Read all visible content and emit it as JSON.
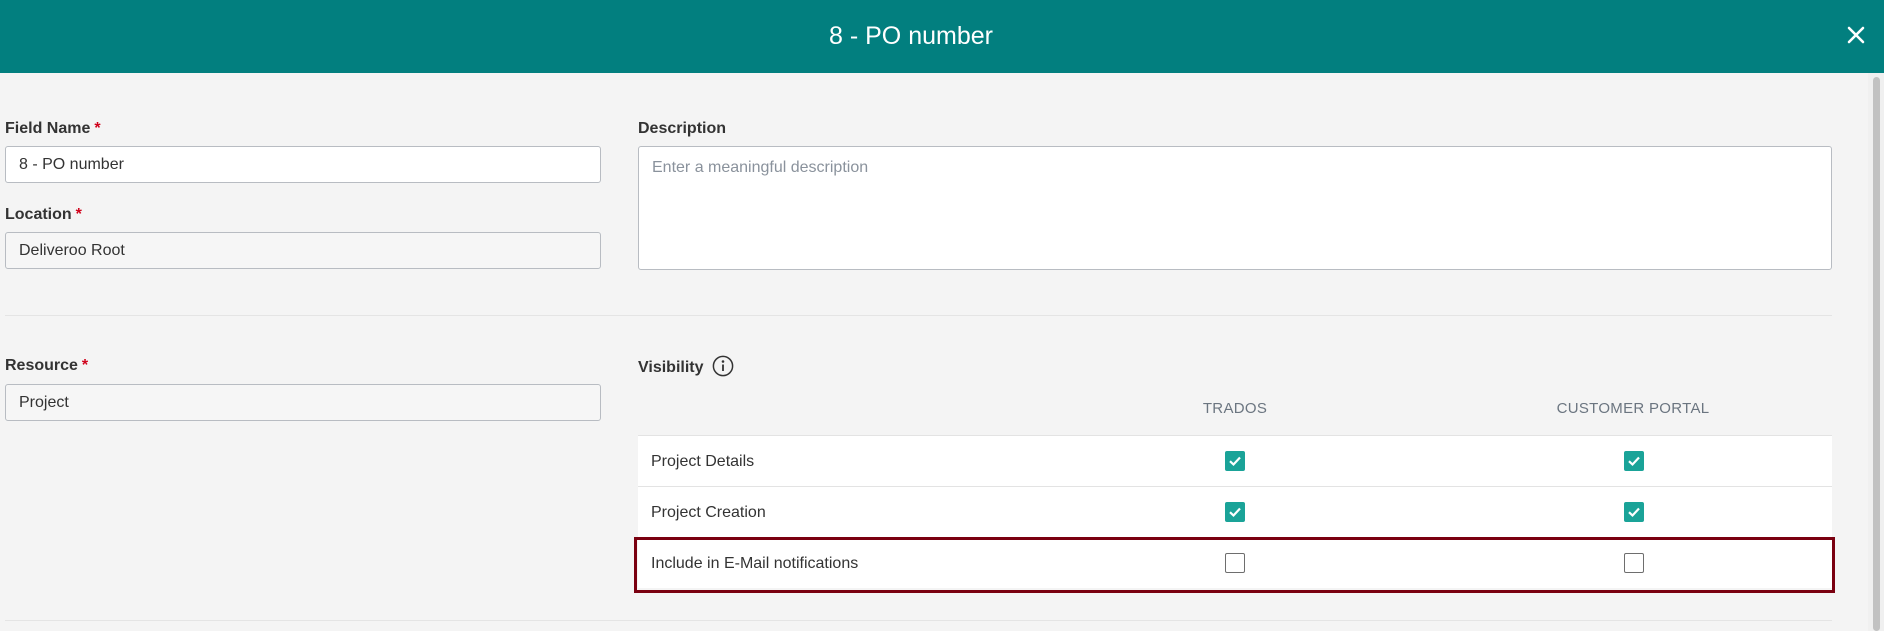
{
  "header": {
    "title": "8 - PO number",
    "close_icon": "close-icon",
    "background": "#027f7f"
  },
  "form": {
    "field_name": {
      "label": "Field Name",
      "required_mark": "*",
      "value": "8 - PO number"
    },
    "location": {
      "label": "Location",
      "required_mark": "*",
      "value": "Deliveroo Root"
    },
    "description": {
      "label": "Description",
      "placeholder": "Enter a meaningful description"
    },
    "resource": {
      "label": "Resource",
      "required_mark": "*",
      "value": "Project"
    }
  },
  "visibility": {
    "label": "Visibility",
    "info_icon": "info-icon",
    "columns": [
      "TRADOS",
      "CUSTOMER PORTAL"
    ],
    "rows": [
      {
        "label": "Project Details",
        "trados": true,
        "customer_portal": true
      },
      {
        "label": "Project Creation",
        "trados": true,
        "customer_portal": true
      },
      {
        "label": "Include in E-Mail notifications",
        "trados": false,
        "customer_portal": false
      }
    ],
    "checkbox_color": "#1aa398",
    "highlight_color": "#7a0010"
  }
}
